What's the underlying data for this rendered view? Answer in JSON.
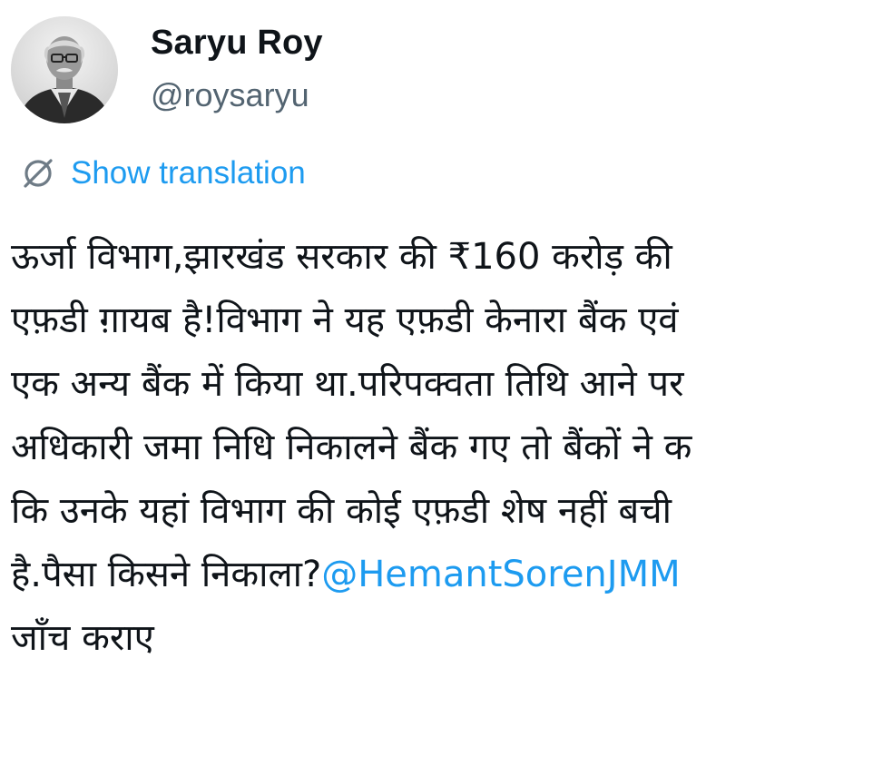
{
  "author": {
    "display_name": "Saryu Roy",
    "handle": "@roysaryu",
    "avatar_icon": "profile-photo"
  },
  "translation": {
    "icon": "globe-strike-icon",
    "label": "Show translation"
  },
  "tweet": {
    "lines": [
      "ऊर्जा विभाग,झारखंड सरकार की ₹160 करोड़ की",
      "एफ़डी ग़ायब है!विभाग ने यह एफ़डी केनारा बैंक एवं",
      "एक अन्य बैंक में किया था.परिपक्वता तिथि आने पर",
      "अधिकारी जमा निधि निकालने बैंक गए तो बैंकों ने क",
      "कि उनके यहां विभाग की कोई एफ़डी शेष नहीं बची",
      "है.पैसा किसने निकाला?",
      "जाँच कराए"
    ],
    "mention": "@HemantSorenJMM"
  },
  "colors": {
    "link": "#1d9bf0",
    "text": "#0f1419",
    "secondary": "#536471",
    "background": "#ffffff"
  }
}
